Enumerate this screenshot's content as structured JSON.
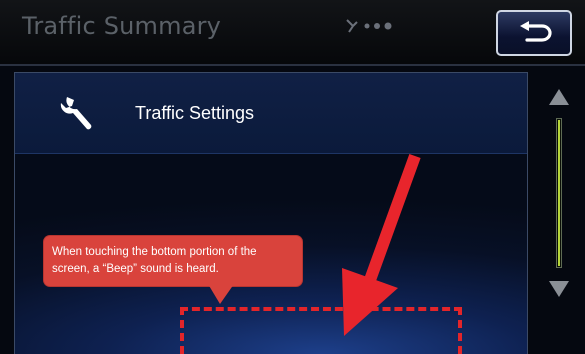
{
  "header": {
    "title": "Traffic Summary",
    "back_icon": "back-return-icon",
    "status_icon": "signal-status-icon"
  },
  "list": {
    "items": [
      {
        "label": "Traffic Settings",
        "icon": "wrench-icon"
      }
    ]
  },
  "scrollbar": {
    "up_icon": "scroll-up-arrow-icon",
    "down_icon": "scroll-down-arrow-icon",
    "thumb_color": "#b7d63a"
  },
  "annotation": {
    "callout_text": "When touching the bottom portion of the screen, a “Beep” sound is heard.",
    "callout_color": "#d9433c",
    "highlight_color": "#e3252a",
    "arrow_icon": "pointer-arrow-icon"
  },
  "colors": {
    "panel_blue": "#0e2151",
    "button_border": "#cfd6e3"
  }
}
